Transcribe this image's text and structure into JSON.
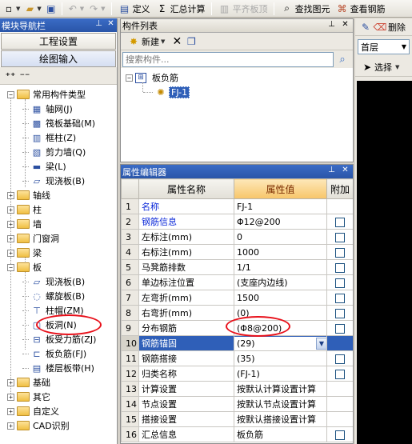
{
  "toolbar": {
    "define": "定义",
    "sum_calc": "汇总计算",
    "flush_slab": "平齐板顶",
    "find_element": "查找图元",
    "view_rebar": "查看钢筋"
  },
  "nav": {
    "title": "模块导航栏",
    "btn_project": "工程设置",
    "btn_drawing": "绘图输入",
    "tree": [
      {
        "label": "常用构件类型",
        "expander": "−",
        "icon": "folder-icon"
      },
      {
        "label": "轴网(J)",
        "icon": "grid-icon"
      },
      {
        "label": "筏板基础(M)",
        "icon": "raft-icon"
      },
      {
        "label": "框柱(Z)",
        "icon": "column-icon"
      },
      {
        "label": "剪力墙(Q)",
        "icon": "wall-icon"
      },
      {
        "label": "梁(L)",
        "icon": "beam-icon"
      },
      {
        "label": "现浇板(B)",
        "icon": "slab-icon"
      },
      {
        "label": "轴线",
        "expander": "+",
        "icon": "folder-icon"
      },
      {
        "label": "柱",
        "expander": "+",
        "icon": "folder-icon"
      },
      {
        "label": "墙",
        "expander": "+",
        "icon": "folder-icon"
      },
      {
        "label": "门窗洞",
        "expander": "+",
        "icon": "folder-icon"
      },
      {
        "label": "梁",
        "expander": "+",
        "icon": "folder-icon"
      },
      {
        "label": "板",
        "expander": "−",
        "icon": "folder-icon"
      },
      {
        "label": "现浇板(B)",
        "icon": "slab-icon"
      },
      {
        "label": "螺旋板(B)",
        "icon": "spiral-slab-icon"
      },
      {
        "label": "柱帽(ZM)",
        "icon": "column-cap-icon"
      },
      {
        "label": "板洞(N)",
        "icon": "slab-hole-icon"
      },
      {
        "label": "板受力筋(ZJ)",
        "icon": "slab-rebar-icon"
      },
      {
        "label": "板负筋(FJ)",
        "icon": "negative-rebar-icon"
      },
      {
        "label": "楼层板带(H)",
        "icon": "floor-strip-icon"
      },
      {
        "label": "基础",
        "expander": "+",
        "icon": "folder-icon"
      },
      {
        "label": "其它",
        "expander": "+",
        "icon": "folder-icon"
      },
      {
        "label": "自定义",
        "expander": "+",
        "icon": "folder-icon"
      },
      {
        "label": "CAD识别",
        "expander": "+",
        "icon": "folder-icon"
      }
    ]
  },
  "comp_list": {
    "title": "构件列表",
    "new_label": "新建",
    "search_placeholder": "搜索构件...",
    "root": "板负筋",
    "item": "FJ-1"
  },
  "props": {
    "title": "属性编辑器",
    "headers": [
      "属性名称",
      "属性值",
      "附加"
    ],
    "rows": [
      {
        "num": "1",
        "name": "名称",
        "value": "FJ-1",
        "blue": true,
        "check": false
      },
      {
        "num": "2",
        "name": "钢筋信息",
        "value": "Φ12@200",
        "blue": true,
        "check": true
      },
      {
        "num": "3",
        "name": "左标注(mm)",
        "value": "0",
        "check": true
      },
      {
        "num": "4",
        "name": "右标注(mm)",
        "value": "1000",
        "check": true
      },
      {
        "num": "5",
        "name": "马凳筋排数",
        "value": "1/1",
        "check": true
      },
      {
        "num": "6",
        "name": "单边标注位置",
        "value": "(支座内边线)",
        "check": true
      },
      {
        "num": "7",
        "name": "左弯折(mm)",
        "value": "1500",
        "check": true
      },
      {
        "num": "8",
        "name": "右弯折(mm)",
        "value": "(0)",
        "check": true
      },
      {
        "num": "9",
        "name": "分布钢筋",
        "value": "(Φ8@200)",
        "check": true
      },
      {
        "num": "10",
        "name": "钢筋锚固",
        "value": "(29)",
        "blue": true,
        "check": false,
        "selected": true
      },
      {
        "num": "11",
        "name": "钢筋搭接",
        "value": "(35)",
        "check": true
      },
      {
        "num": "12",
        "name": "归类名称",
        "value": "(FJ-1)",
        "check": true
      },
      {
        "num": "13",
        "name": "计算设置",
        "value": "按默认计算设置计算",
        "check": false
      },
      {
        "num": "14",
        "name": "节点设置",
        "value": "按默认节点设置计算",
        "check": false
      },
      {
        "num": "15",
        "name": "搭接设置",
        "value": "按默认搭接设置计算",
        "check": false
      },
      {
        "num": "16",
        "name": "汇总信息",
        "value": "板负筋",
        "check": true
      }
    ]
  },
  "right": {
    "delete_label": "删除",
    "floor_value": "首层",
    "select_label": "选择"
  }
}
